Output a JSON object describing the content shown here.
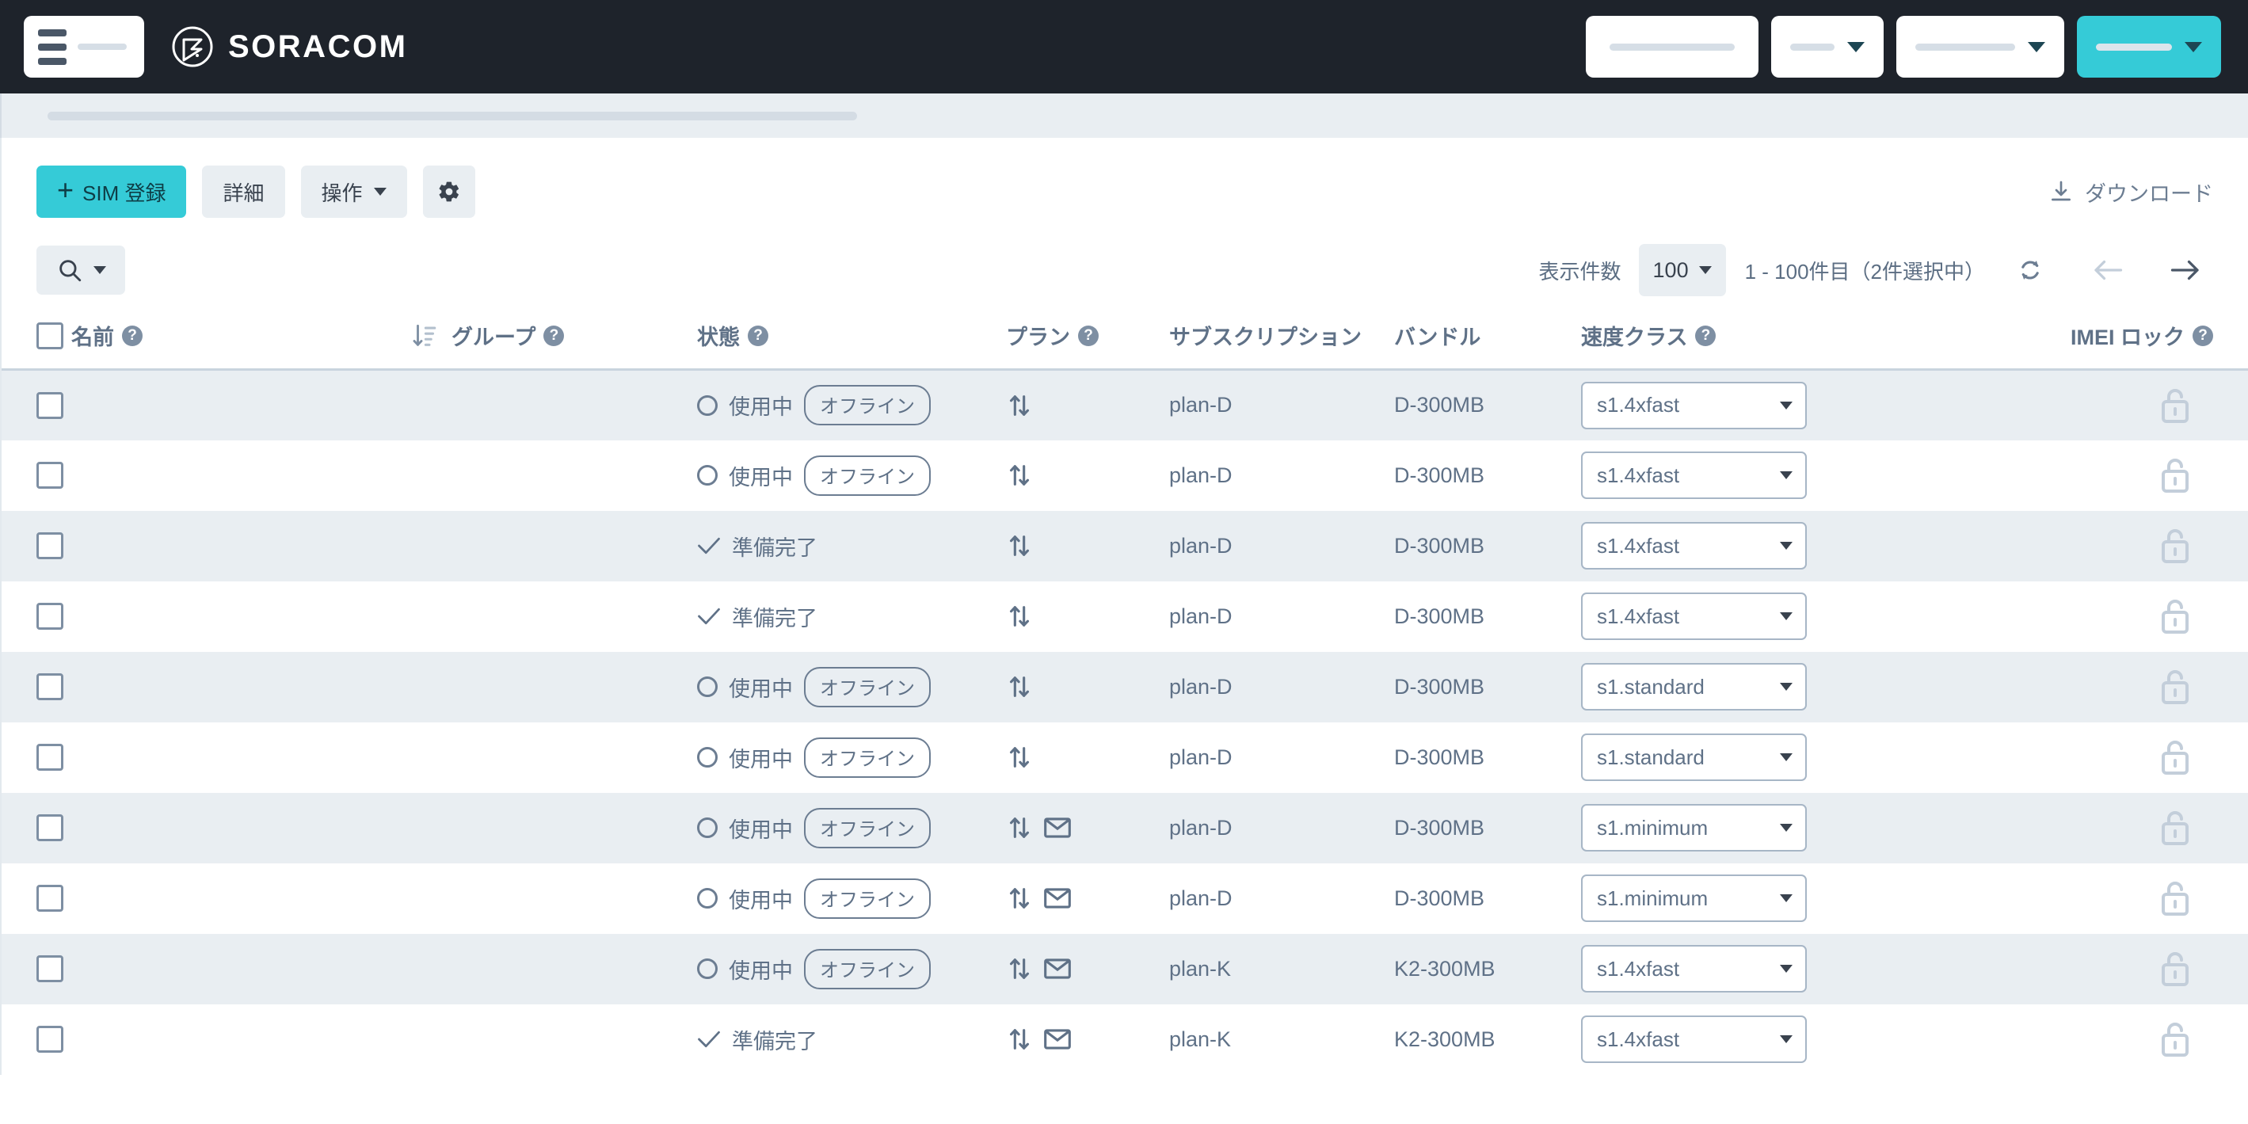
{
  "header": {
    "brand_name": "SORACOM",
    "menu_icon": "hamburger-icon",
    "logo_icon": "soracom-logo-icon",
    "buttons": [
      {
        "name": "header-button-1",
        "redacted": true,
        "width": 158,
        "caret": false,
        "accent": false
      },
      {
        "name": "header-button-2",
        "redacted": true,
        "width": 60,
        "caret": true,
        "accent": false
      },
      {
        "name": "header-button-3",
        "redacted": true,
        "width": 134,
        "caret": true,
        "accent": false
      },
      {
        "name": "header-button-4",
        "redacted": true,
        "width": 104,
        "caret": true,
        "accent": true
      }
    ]
  },
  "breadcrumb": {
    "redacted": true
  },
  "toolbar": {
    "register_sim_label": "SIM 登録",
    "register_sim_icon": "plus-icon",
    "details_label": "詳細",
    "operation_label": "操作",
    "settings_icon": "gear-icon",
    "download_label": "ダウンロード",
    "download_icon": "download-icon"
  },
  "subbar": {
    "search_icon": "search-icon",
    "page_size_label": "表示件数",
    "page_size_value": "100",
    "range_label": "1 - 100件目（2件選択中）",
    "refresh_icon": "refresh-icon",
    "prev_icon": "arrow-left-icon",
    "next_icon": "arrow-right-icon",
    "prev_disabled": true
  },
  "table": {
    "select_all_label": "",
    "columns": [
      {
        "key": "checkbox",
        "label": "",
        "help": false,
        "sort": false
      },
      {
        "key": "name",
        "label": "名前",
        "help": true,
        "sort": false
      },
      {
        "key": "group",
        "label": "グループ",
        "help": true,
        "sort": true
      },
      {
        "key": "state",
        "label": "状態",
        "help": true,
        "sort": false
      },
      {
        "key": "plan",
        "label": "プラン",
        "help": true,
        "sort": false
      },
      {
        "key": "subscription",
        "label": "サブスクリプション",
        "help": false,
        "sort": false
      },
      {
        "key": "bundle",
        "label": "バンドル",
        "help": false,
        "sort": false
      },
      {
        "key": "speed_class",
        "label": "速度クラス",
        "help": true,
        "sort": false
      },
      {
        "key": "imei_lock",
        "label": "IMEI ロック",
        "help": true,
        "sort": false
      }
    ],
    "sort_icon": "sort-descending-icon",
    "rows": [
      {
        "checked": false,
        "name_w": 248,
        "group_w": 134,
        "state": "使用中",
        "state_icon": "circle-icon",
        "badge": "オフライン",
        "proto_icons": [
          "data-transfer-icon"
        ],
        "plan": "plan-D",
        "subscription": "",
        "bundle": "D-300MB",
        "speed_class": "s1.4xfast",
        "imei_lock_icon": "unlock-icon"
      },
      {
        "checked": false,
        "name_w": 172,
        "group_w": 88,
        "state": "使用中",
        "state_icon": "circle-icon",
        "badge": "オフライン",
        "proto_icons": [
          "data-transfer-icon"
        ],
        "plan": "plan-D",
        "subscription": "",
        "bundle": "D-300MB",
        "speed_class": "s1.4xfast",
        "imei_lock_icon": "unlock-icon"
      },
      {
        "checked": false,
        "name_w": 112,
        "group_w": 172,
        "state": "準備完了",
        "state_icon": "check-icon",
        "badge": "",
        "proto_icons": [
          "data-transfer-icon"
        ],
        "plan": "plan-D",
        "subscription": "",
        "bundle": "D-300MB",
        "speed_class": "s1.4xfast",
        "imei_lock_icon": "unlock-icon"
      },
      {
        "checked": false,
        "name_w": 208,
        "group_w": 120,
        "state": "準備完了",
        "state_icon": "check-icon",
        "badge": "",
        "proto_icons": [
          "data-transfer-icon"
        ],
        "plan": "plan-D",
        "subscription": "",
        "bundle": "D-300MB",
        "speed_class": "s1.4xfast",
        "imei_lock_icon": "unlock-icon"
      },
      {
        "checked": false,
        "name_w": 132,
        "group_w": 76,
        "state": "使用中",
        "state_icon": "circle-icon",
        "badge": "オフライン",
        "proto_icons": [
          "data-transfer-icon"
        ],
        "plan": "plan-D",
        "subscription": "",
        "bundle": "D-300MB",
        "speed_class": "s1.standard",
        "imei_lock_icon": "unlock-icon"
      },
      {
        "checked": false,
        "name_w": 184,
        "group_w": 98,
        "state": "使用中",
        "state_icon": "circle-icon",
        "badge": "オフライン",
        "proto_icons": [
          "data-transfer-icon"
        ],
        "plan": "plan-D",
        "subscription": "",
        "bundle": "D-300MB",
        "speed_class": "s1.standard",
        "imei_lock_icon": "unlock-icon"
      },
      {
        "checked": false,
        "name_w": 38,
        "group_w": 46,
        "state": "使用中",
        "state_icon": "circle-icon",
        "badge": "オフライン",
        "proto_icons": [
          "data-transfer-icon",
          "mail-icon"
        ],
        "plan": "plan-D",
        "subscription": "",
        "bundle": "D-300MB",
        "speed_class": "s1.minimum",
        "imei_lock_icon": "unlock-icon"
      },
      {
        "checked": false,
        "name_w": 108,
        "group_w": 82,
        "state": "使用中",
        "state_icon": "circle-icon",
        "badge": "オフライン",
        "proto_icons": [
          "data-transfer-icon",
          "mail-icon"
        ],
        "plan": "plan-D",
        "subscription": "",
        "bundle": "D-300MB",
        "speed_class": "s1.minimum",
        "imei_lock_icon": "unlock-icon"
      },
      {
        "checked": false,
        "name_w": 68,
        "group_w": 118,
        "state": "使用中",
        "state_icon": "circle-icon",
        "badge": "オフライン",
        "proto_icons": [
          "data-transfer-icon",
          "mail-icon"
        ],
        "plan": "plan-K",
        "subscription": "",
        "bundle": "K2-300MB",
        "speed_class": "s1.4xfast",
        "imei_lock_icon": "unlock-icon"
      },
      {
        "checked": false,
        "name_w": 162,
        "group_w": 48,
        "state": "準備完了",
        "state_icon": "check-icon",
        "badge": "",
        "proto_icons": [
          "data-transfer-icon",
          "mail-icon"
        ],
        "plan": "plan-K",
        "subscription": "",
        "bundle": "K2-300MB",
        "speed_class": "s1.4xfast",
        "imei_lock_icon": "unlock-icon"
      }
    ]
  },
  "colors": {
    "header_bg": "#1E232B",
    "accent": "#35CBD7",
    "stripe": "#E9EEF2",
    "text": "#5F7187",
    "redact": "#D4DCE4"
  }
}
